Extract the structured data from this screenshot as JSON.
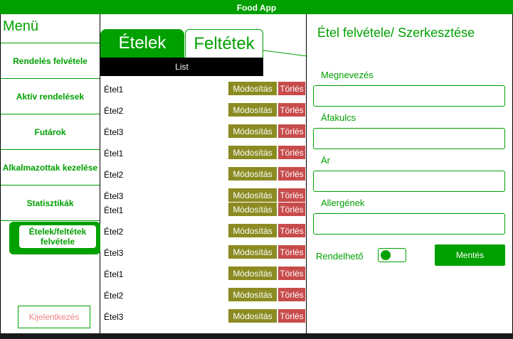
{
  "app": {
    "title": "Food App"
  },
  "sidebar": {
    "title": "Menü",
    "items": [
      {
        "label": "Rendelés felvétele"
      },
      {
        "label": "Aktív rendelések"
      },
      {
        "label": "Futárok"
      },
      {
        "label": "Alkalmazottak kezelése"
      },
      {
        "label": "Statisztikák"
      }
    ],
    "active_item": {
      "label": "Ételek/feltétek felvétele"
    },
    "logout_label": "Kijelentkezés"
  },
  "list_panel": {
    "tabs": [
      {
        "label": "Ételek",
        "active": true
      },
      {
        "label": "Feltétek",
        "active": false
      }
    ],
    "header": "List",
    "rows": [
      {
        "name": "Étel1"
      },
      {
        "name": "Étel2"
      },
      {
        "name": "Étel3"
      },
      {
        "name": "Étel1"
      },
      {
        "name": "Étel2"
      },
      {
        "name": "Étel3"
      },
      {
        "name": "Étel1"
      },
      {
        "name": "Étel2"
      },
      {
        "name": "Étel3"
      },
      {
        "name": "Étel1"
      },
      {
        "name": "Étel2"
      },
      {
        "name": "Étel3"
      }
    ],
    "edit_label": "Módosítás",
    "delete_label": "Törlés"
  },
  "form": {
    "title": "Étel felvétele/ Szerkesztése",
    "fields": [
      {
        "label": "Megnevezés",
        "value": ""
      },
      {
        "label": "Áfakulcs",
        "value": ""
      },
      {
        "label": "Ár",
        "value": ""
      },
      {
        "label": "Allergének",
        "value": ""
      }
    ],
    "orderable_label": "Rendelhető",
    "orderable": true,
    "save_label": "Mentés"
  },
  "colors": {
    "accent": "#00a000",
    "edit": "#8b8b22",
    "delete": "#c84b4b",
    "logout_text": "#f08080"
  }
}
